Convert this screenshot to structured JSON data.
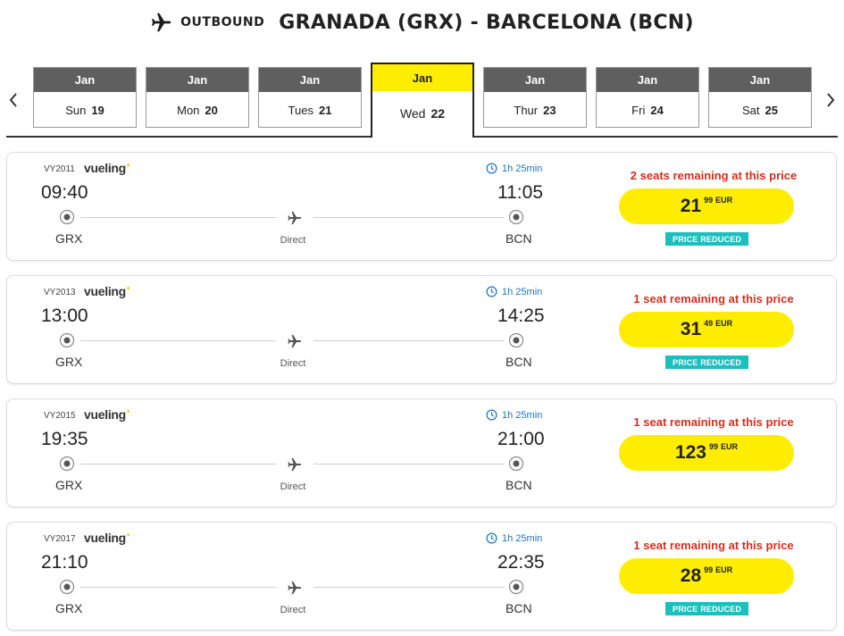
{
  "header": {
    "direction_label": "OUTBOUND",
    "route": "GRANADA (GRX) - BARCELONA (BCN)"
  },
  "dates": [
    {
      "month": "Jan",
      "weekday": "Sun",
      "day": "19",
      "selected": false
    },
    {
      "month": "Jan",
      "weekday": "Mon",
      "day": "20",
      "selected": false
    },
    {
      "month": "Jan",
      "weekday": "Tues",
      "day": "21",
      "selected": false
    },
    {
      "month": "Jan",
      "weekday": "Wed",
      "day": "22",
      "selected": true
    },
    {
      "month": "Jan",
      "weekday": "Thur",
      "day": "23",
      "selected": false
    },
    {
      "month": "Jan",
      "weekday": "Fri",
      "day": "24",
      "selected": false
    },
    {
      "month": "Jan",
      "weekday": "Sat",
      "day": "25",
      "selected": false
    }
  ],
  "flights": [
    {
      "flight_number": "VY2011",
      "airline": "vueling",
      "duration": "1h 25min",
      "departure_time": "09:40",
      "arrival_time": "11:05",
      "origin": "GRX",
      "destination": "BCN",
      "stops": "Direct",
      "availability": "2 seats remaining at this price",
      "price_int": "21",
      "price_dec": "99",
      "currency": "EUR",
      "badge": "PRICE REDUCED"
    },
    {
      "flight_number": "VY2013",
      "airline": "vueling",
      "duration": "1h 25min",
      "departure_time": "13:00",
      "arrival_time": "14:25",
      "origin": "GRX",
      "destination": "BCN",
      "stops": "Direct",
      "availability": "1 seat remaining at this price",
      "price_int": "31",
      "price_dec": "49",
      "currency": "EUR",
      "badge": "PRICE REDUCED"
    },
    {
      "flight_number": "VY2015",
      "airline": "vueling",
      "duration": "1h 25min",
      "departure_time": "19:35",
      "arrival_time": "21:00",
      "origin": "GRX",
      "destination": "BCN",
      "stops": "Direct",
      "availability": "1 seat remaining at this price",
      "price_int": "123",
      "price_dec": "99",
      "currency": "EUR",
      "badge": ""
    },
    {
      "flight_number": "VY2017",
      "airline": "vueling",
      "duration": "1h 25min",
      "departure_time": "21:10",
      "arrival_time": "22:35",
      "origin": "GRX",
      "destination": "BCN",
      "stops": "Direct",
      "availability": "1 seat remaining at this price",
      "price_int": "28",
      "price_dec": "99",
      "currency": "EUR",
      "badge": "PRICE REDUCED"
    }
  ],
  "colors": {
    "accent_yellow": "#ffed00",
    "month_header_gray": "#5f5f5f",
    "availability_red": "#d32f1e",
    "duration_blue": "#1a73c8",
    "badge_teal": "#1bbfbf"
  },
  "icons": {
    "header": "airplane-icon",
    "prev": "chevron-left-icon",
    "next": "chevron-right-icon",
    "duration": "clock-icon",
    "route_node": "circle-dot-icon",
    "route_mid": "airplane-icon"
  }
}
